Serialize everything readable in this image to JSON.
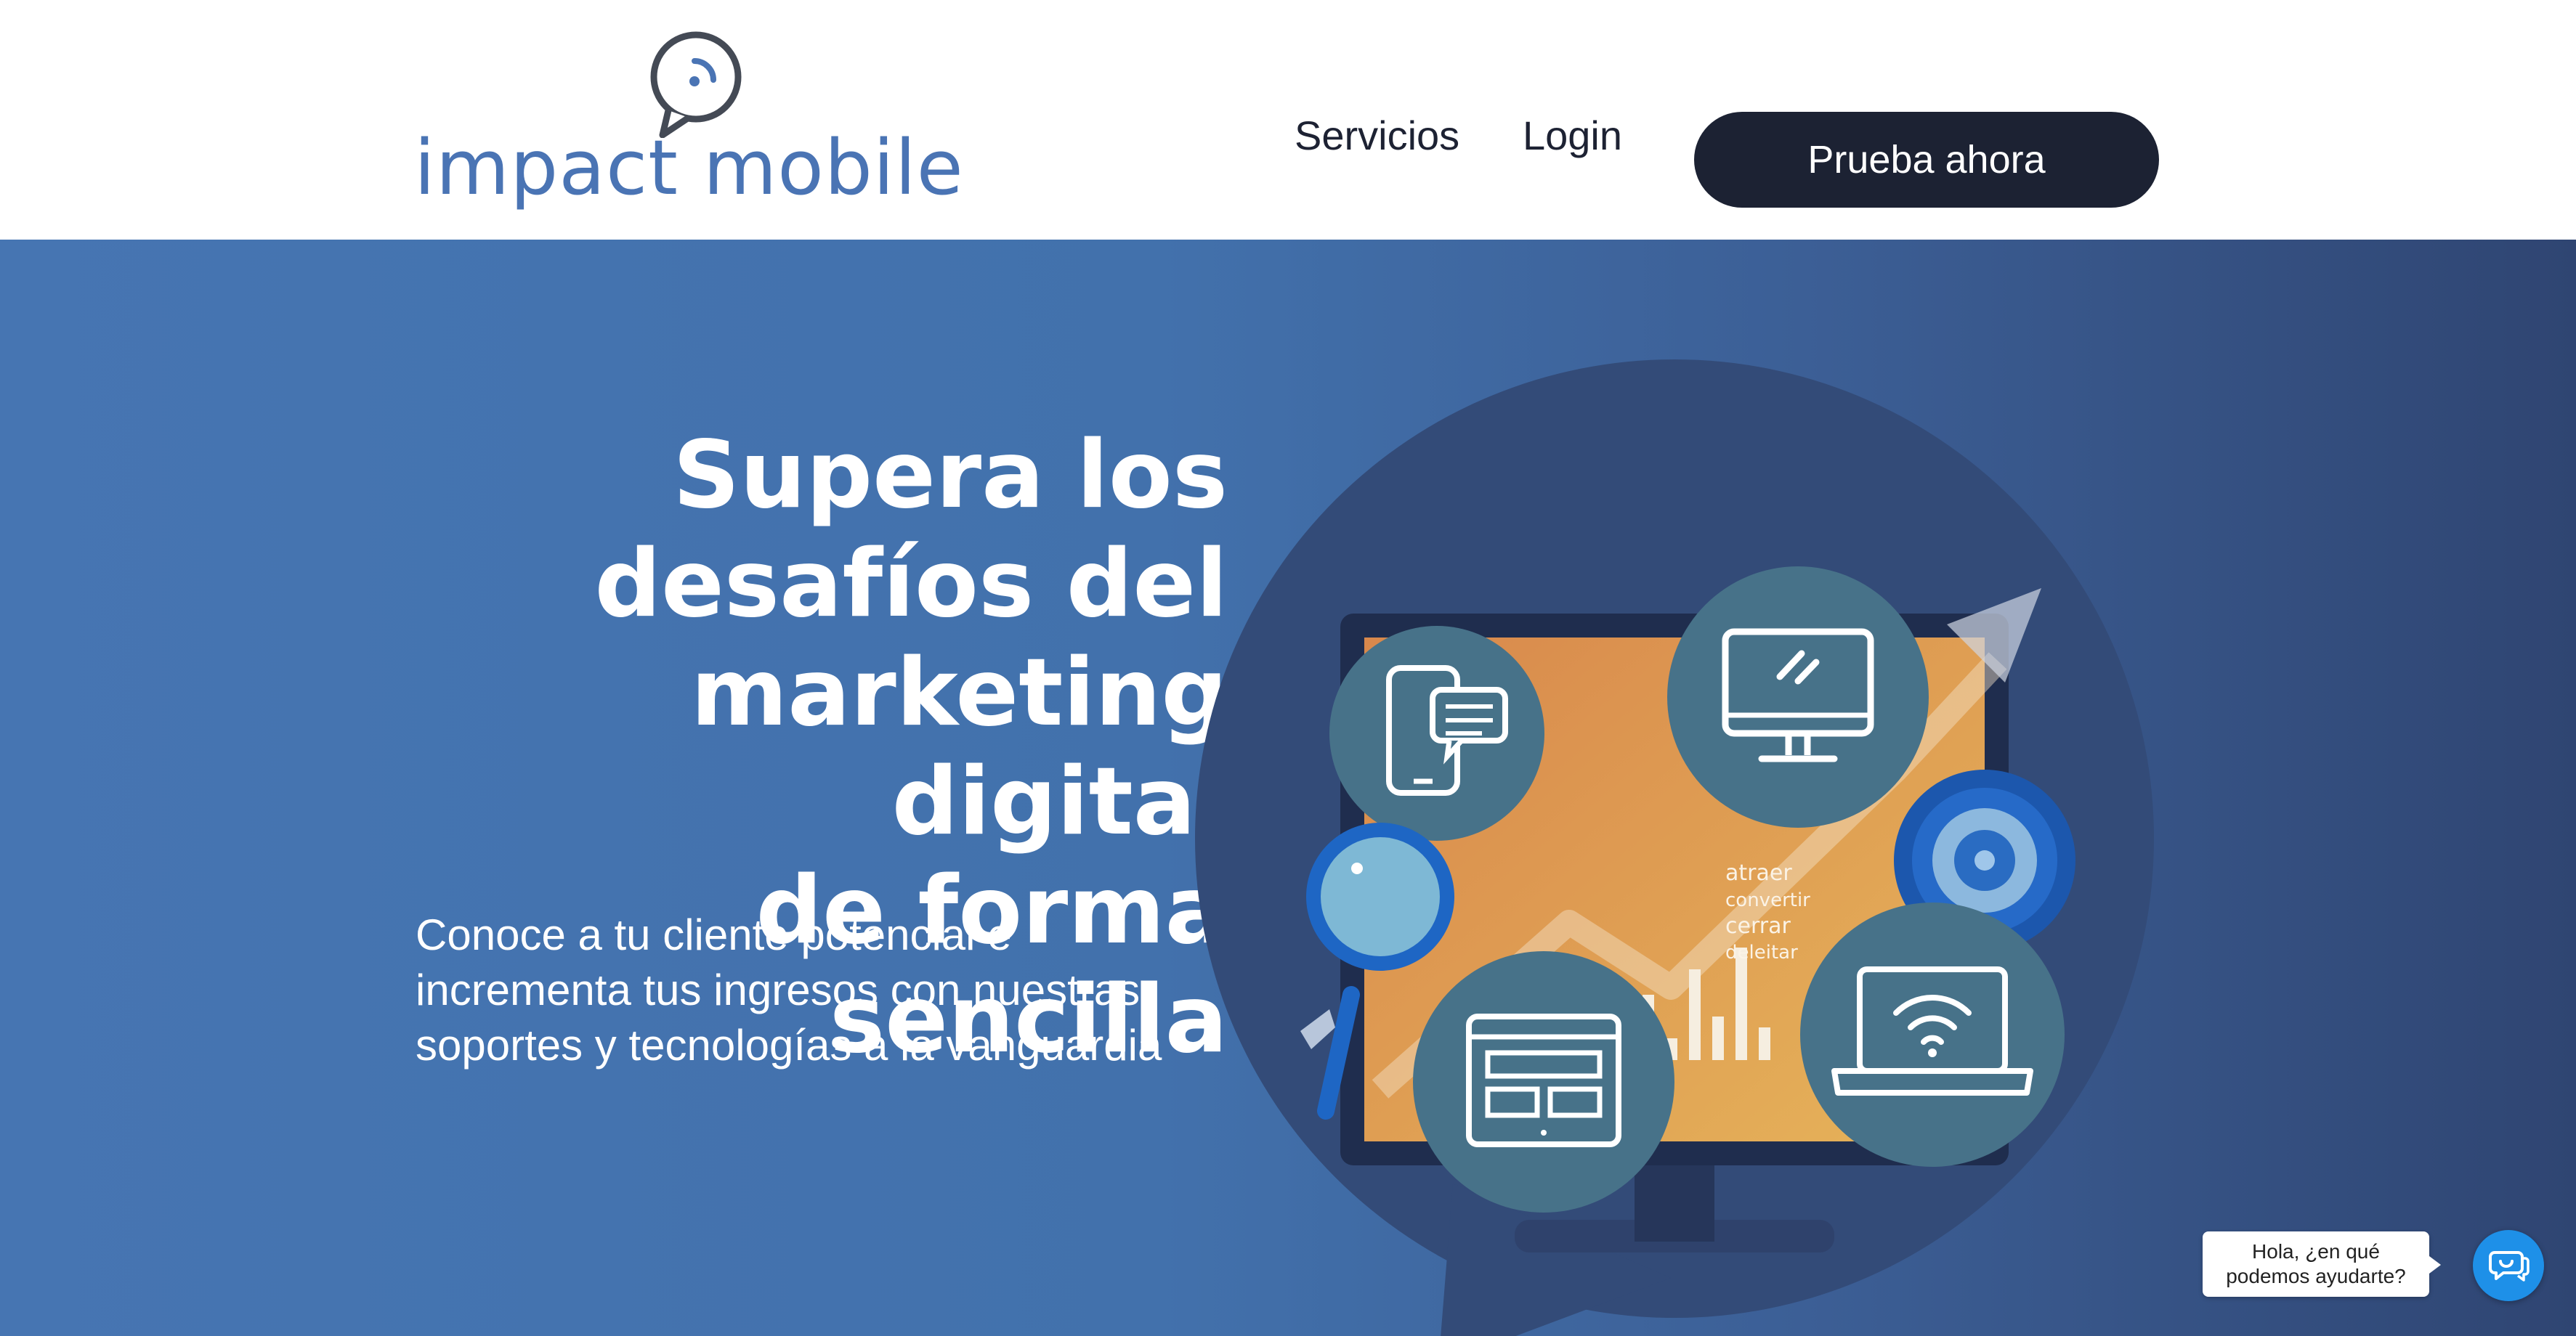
{
  "brand": {
    "name": "impact mobile",
    "color": "#4a74b4"
  },
  "nav": {
    "servicios": "Servicios",
    "login": "Login",
    "cta": "Prueba ahora"
  },
  "hero": {
    "headline": [
      "Supera los",
      "desafíos del",
      "marketing digital",
      "de forma sencilla"
    ],
    "subtext": [
      "Conoce a tu cliente potencial e",
      "incrementa tus ingresos con nuestras",
      "soportes y tecnologías a la vanguardia"
    ],
    "screen_words": [
      "atraer",
      "convertir",
      "cerrar",
      "deleitar"
    ]
  },
  "chat": {
    "bubble_lines": [
      "Hola, ¿en qué",
      "podemos ayudarte?"
    ],
    "icon": "chat-icon"
  },
  "colors": {
    "hero": "#4271ac",
    "cta": "#1c2233",
    "chat": "#1e90e8"
  }
}
